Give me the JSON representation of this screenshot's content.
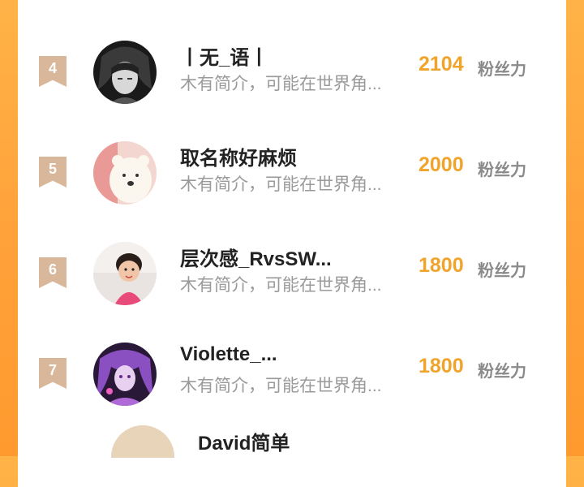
{
  "list": {
    "entries": [
      {
        "rank": "4",
        "name": "丨无_语丨",
        "desc": "木有简介，可能在世界角...",
        "score": "2104",
        "unit": "粉丝力",
        "avatar": "dark-anime-avatar"
      },
      {
        "rank": "5",
        "name": "取名称好麻烦",
        "desc": "木有简介，可能在世界角...",
        "score": "2000",
        "unit": "粉丝力",
        "avatar": "bear-avatar"
      },
      {
        "rank": "6",
        "name": "层次感_RvsSW...",
        "desc": "木有简介，可能在世界角...",
        "score": "1800",
        "unit": "粉丝力",
        "avatar": "child-photo-avatar"
      },
      {
        "rank": "7",
        "name": "Violette_...",
        "desc": "木有简介，可能在世界角...",
        "score": "1800",
        "unit": "粉丝力",
        "avatar": "purple-anime-avatar"
      }
    ],
    "partial_next_name": "David简单"
  },
  "colors": {
    "background": "#ffa23a",
    "score": "#f2a32a",
    "rank_badge": "#d9b79a"
  }
}
